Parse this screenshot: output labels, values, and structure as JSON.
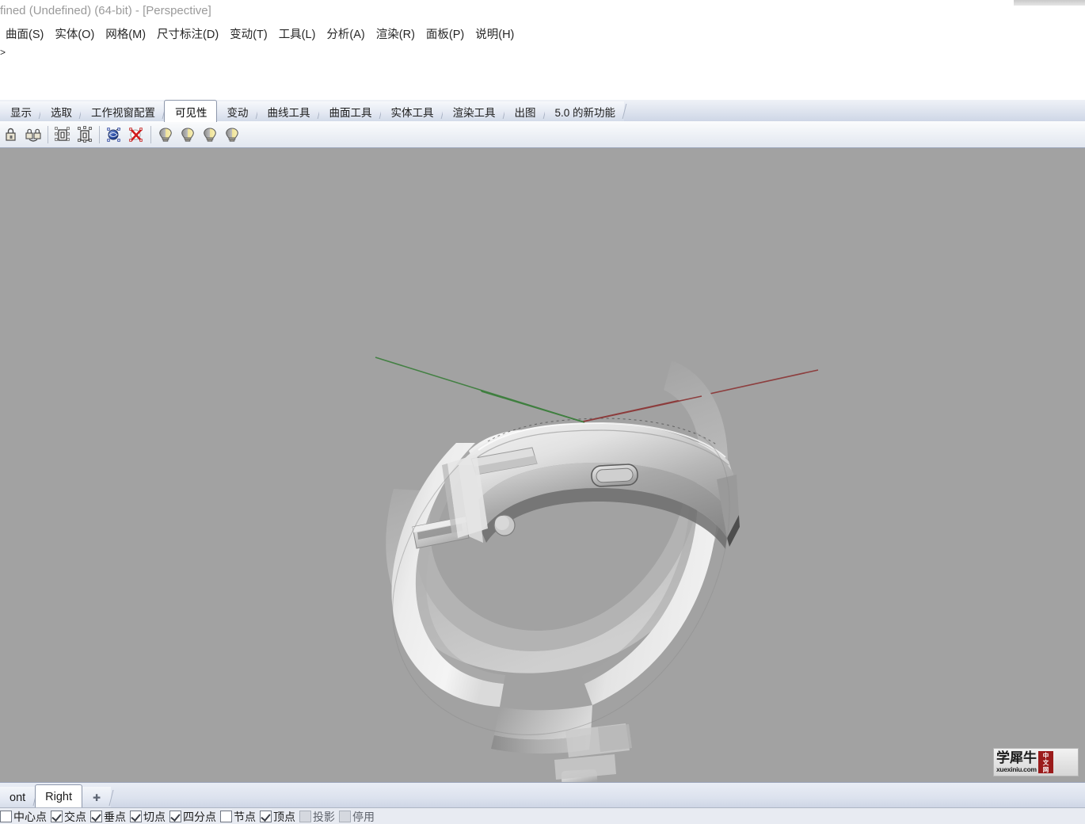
{
  "window": {
    "title": "fined (Undefined) (64-bit) - [Perspective]"
  },
  "menubar": {
    "items": [
      {
        "label": "曲面(S)",
        "name": "menu-surface"
      },
      {
        "label": "实体(O)",
        "name": "menu-solid"
      },
      {
        "label": "网格(M)",
        "name": "menu-mesh"
      },
      {
        "label": "尺寸标注(D)",
        "name": "menu-dimension"
      },
      {
        "label": "变动(T)",
        "name": "menu-transform"
      },
      {
        "label": "工具(L)",
        "name": "menu-tools"
      },
      {
        "label": "分析(A)",
        "name": "menu-analyze"
      },
      {
        "label": "渲染(R)",
        "name": "menu-render"
      },
      {
        "label": "面板(P)",
        "name": "menu-panels"
      },
      {
        "label": "说明(H)",
        "name": "menu-help"
      }
    ]
  },
  "command": {
    "prompt": ">",
    "placeholder": ""
  },
  "tabstrip": {
    "tabs": [
      {
        "label": "显示",
        "active": false
      },
      {
        "label": "选取",
        "active": false
      },
      {
        "label": "工作视窗配置",
        "active": false
      },
      {
        "label": "可见性",
        "active": true
      },
      {
        "label": "变动",
        "active": false
      },
      {
        "label": "曲线工具",
        "active": false
      },
      {
        "label": "曲面工具",
        "active": false
      },
      {
        "label": "实体工具",
        "active": false
      },
      {
        "label": "渲染工具",
        "active": false
      },
      {
        "label": "出图",
        "active": false
      },
      {
        "label": "5.0 的新功能",
        "active": false
      }
    ]
  },
  "toolbar": {
    "buttons": [
      {
        "name": "lock-object-icon",
        "kind": "lock"
      },
      {
        "name": "unlock-object-icon",
        "kind": "unlock"
      },
      {
        "name": "sep",
        "kind": "separator"
      },
      {
        "name": "select-group-icon",
        "kind": "group1"
      },
      {
        "name": "select-objects-icon",
        "kind": "group2"
      },
      {
        "name": "sep",
        "kind": "separator"
      },
      {
        "name": "show-objects-icon",
        "kind": "show"
      },
      {
        "name": "hide-objects-icon",
        "kind": "hide"
      },
      {
        "name": "sep",
        "kind": "separator"
      },
      {
        "name": "light-on-icon",
        "kind": "bulb"
      },
      {
        "name": "light-off-icon",
        "kind": "bulb"
      },
      {
        "name": "light-toggle-icon",
        "kind": "bulb"
      },
      {
        "name": "light-properties-icon",
        "kind": "bulb"
      }
    ]
  },
  "viewport": {
    "label": "Perspective",
    "background_color": "#a2a2a2",
    "axis_colors": {
      "x": "#8c3a3a",
      "y": "#3f7f3f"
    },
    "model_name": "smart-band-3d-model"
  },
  "watermark": {
    "cn_text": "学犀牛",
    "url": "xuexiniu.com",
    "badge_lines": [
      "中",
      "文",
      "网"
    ],
    "badge_color": "#9b1b1b"
  },
  "viewport_tabs": {
    "tabs": [
      {
        "label": "ont",
        "active": false
      },
      {
        "label": "Right",
        "active": true
      }
    ],
    "add_label": "✚"
  },
  "osnap": {
    "items": [
      {
        "label": "中心点",
        "checked": false,
        "disabled": false,
        "name": "osnap-center"
      },
      {
        "label": "交点",
        "checked": true,
        "disabled": false,
        "name": "osnap-intersection"
      },
      {
        "label": "垂点",
        "checked": true,
        "disabled": false,
        "name": "osnap-perpendicular"
      },
      {
        "label": "切点",
        "checked": true,
        "disabled": false,
        "name": "osnap-tangent"
      },
      {
        "label": "四分点",
        "checked": true,
        "disabled": false,
        "name": "osnap-quadrant"
      },
      {
        "label": "节点",
        "checked": false,
        "disabled": false,
        "name": "osnap-knot"
      },
      {
        "label": "顶点",
        "checked": true,
        "disabled": false,
        "name": "osnap-vertex"
      },
      {
        "label": "投影",
        "checked": false,
        "disabled": true,
        "name": "osnap-project"
      },
      {
        "label": "停用",
        "checked": false,
        "disabled": true,
        "name": "osnap-disable"
      }
    ]
  }
}
